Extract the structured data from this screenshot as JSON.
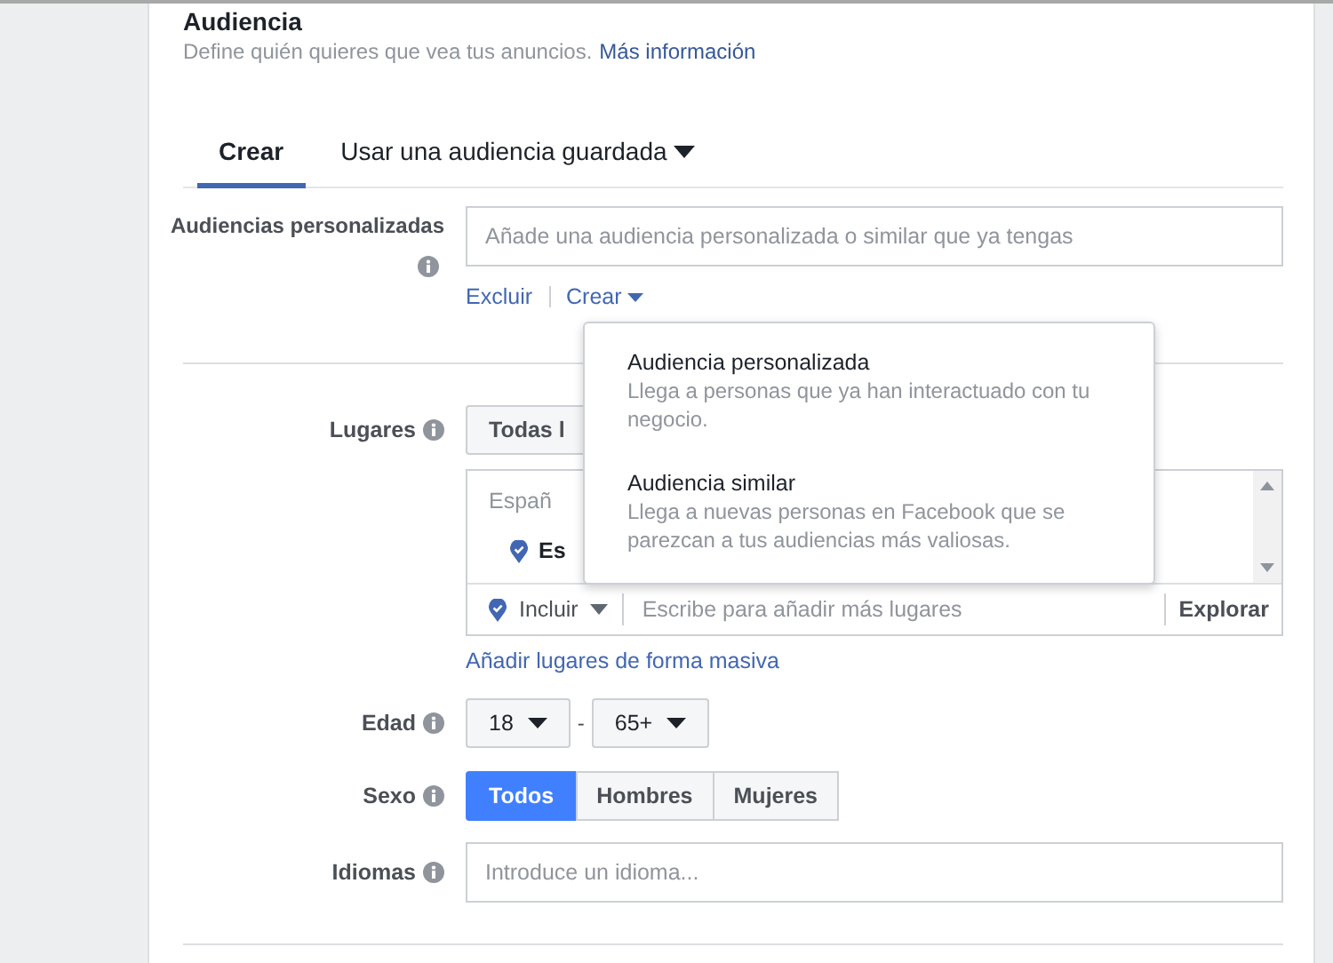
{
  "section": {
    "title": "Audiencia",
    "description": "Define quién quieres que vea tus anuncios.",
    "link": "Más información"
  },
  "tabs": [
    {
      "label": "Crear",
      "selected": true,
      "dropdown": false
    },
    {
      "label": "Usar una audiencia guardada",
      "selected": false,
      "dropdown": true
    }
  ],
  "custom_audiences": {
    "label": "Audiencias personalizadas",
    "placeholder": "Añade una audiencia personalizada o similar que ya tengas",
    "actions": [
      {
        "label": "Excluir",
        "caret": false
      },
      {
        "label": "Crear",
        "caret": true
      }
    ]
  },
  "create_menu": {
    "items": [
      {
        "title": "Audiencia personalizada",
        "description": "Llega a personas que ya han interactuado con tu negocio."
      },
      {
        "title": "Audiencia similar",
        "description": "Llega a nuevas personas en Facebook que se parezcan a tus audiencias más valiosas."
      }
    ]
  },
  "locations": {
    "label": "Lugares",
    "scope_button": "Todas l",
    "list_header": "Españ",
    "location": "Es",
    "include": "Incluir",
    "placeholder": "Escribe para añadir más lugares",
    "explore": "Explorar",
    "bulk_link": "Añadir lugares de forma masiva"
  },
  "age": {
    "label": "Edad",
    "min": "18",
    "separator": "-",
    "max": "65+"
  },
  "gender": {
    "label": "Sexo",
    "options": [
      {
        "label": "Todos",
        "selected": true
      },
      {
        "label": "Hombres",
        "selected": false
      },
      {
        "label": "Mujeres",
        "selected": false
      }
    ]
  },
  "languages": {
    "label": "Idiomas",
    "placeholder": "Introduce un idioma..."
  }
}
